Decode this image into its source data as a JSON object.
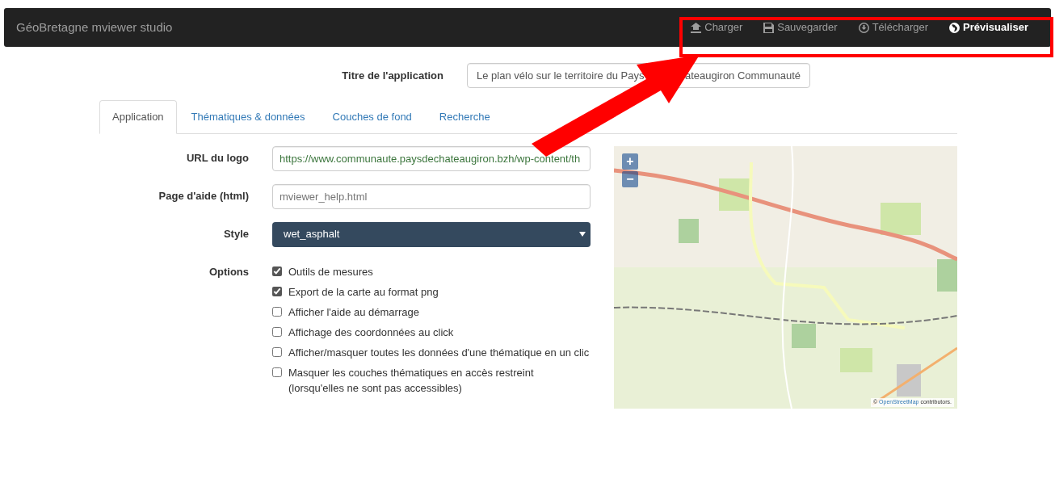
{
  "navbar": {
    "brand": "GéoBretagne mviewer studio",
    "actions": [
      {
        "label": "Charger",
        "emphasized": false
      },
      {
        "label": "Sauvegarder",
        "emphasized": false
      },
      {
        "label": "Télécharger",
        "emphasized": false
      },
      {
        "label": "Prévisualiser",
        "emphasized": true
      }
    ]
  },
  "title_field": {
    "label": "Titre de l'application",
    "value_visible_start": "Le plan vélo sur le territoire du Pays",
    "value_visible_end": "ateaugiron Communauté"
  },
  "tabs": [
    {
      "label": "Application",
      "selected": true
    },
    {
      "label": "Thématiques & données",
      "selected": false
    },
    {
      "label": "Couches de fond",
      "selected": false
    },
    {
      "label": "Recherche",
      "selected": false
    }
  ],
  "form": {
    "logo_url": {
      "label": "URL du logo",
      "value": "https://www.communaute.paysdechateaugiron.bzh/wp-content/th"
    },
    "help_page": {
      "label": "Page d'aide (html)",
      "placeholder": "mviewer_help.html"
    },
    "style": {
      "label": "Style",
      "value": "wet_asphalt"
    },
    "options_label": "Options",
    "options": [
      {
        "label": "Outils de mesures",
        "checked": true
      },
      {
        "label": "Export de la carte au format png",
        "checked": true
      },
      {
        "label": "Afficher l'aide au démarrage",
        "checked": false
      },
      {
        "label": "Affichage des coordonnées au click",
        "checked": false
      },
      {
        "label": "Afficher/masquer toutes les données d'une thématique en un clic",
        "checked": false
      },
      {
        "label": "Masquer les couches thématiques en accès restreint (lorsqu'elles ne sont pas accessibles)",
        "checked": false
      }
    ]
  },
  "map": {
    "zoom_in": "+",
    "zoom_out": "−",
    "attribution_symbol": "©",
    "attribution_link": "OpenStreetMap",
    "attribution_text": "contributors."
  }
}
